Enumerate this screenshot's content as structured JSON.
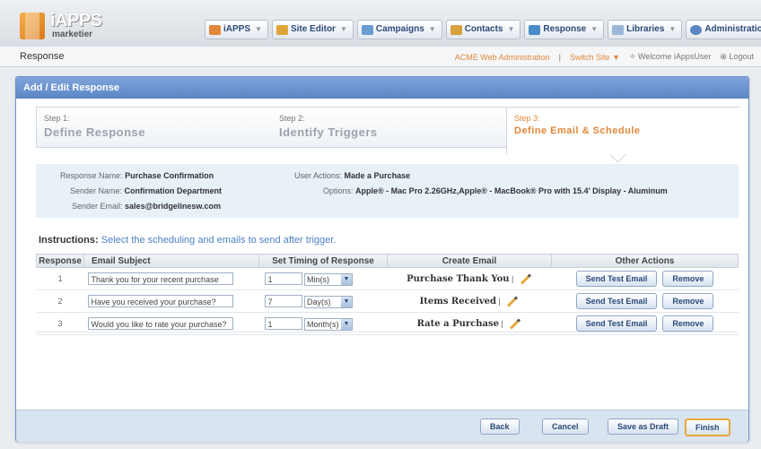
{
  "app": {
    "logo_title": "iAPPS",
    "logo_sub": "marketier"
  },
  "nav": [
    {
      "label": "iAPPS",
      "color": "#e0873a"
    },
    {
      "label": "Site Editor",
      "color": "#e0a53a"
    },
    {
      "label": "Campaigns",
      "color": "#6a9bd3"
    },
    {
      "label": "Contacts",
      "color": "#d9a13c"
    },
    {
      "label": "Response",
      "color": "#4a8bc9"
    },
    {
      "label": "Libraries",
      "color": "#9ab7d9"
    },
    {
      "label": "Administration",
      "color": "#5b86c5"
    }
  ],
  "subbar": {
    "page_title": "Response",
    "site_admin": "ACME Web Administration",
    "switch_site": "Switch Site",
    "welcome": "Welcome iAppsUser",
    "logout": "Logout"
  },
  "panel": {
    "title": "Add / Edit Response"
  },
  "steps": [
    {
      "num": "Step 1:",
      "title": "Define Response"
    },
    {
      "num": "Step 2:",
      "title": "Identify Triggers"
    },
    {
      "num": "Step 3:",
      "title": "Define Email & Schedule"
    }
  ],
  "summary": {
    "response_name_label": "Response Name:",
    "response_name": "Purchase Confirmation",
    "sender_name_label": "Sender Name:",
    "sender_name": "Confirmation Department",
    "sender_email_label": "Sender Email:",
    "sender_email": "sales@bridgelinesw.com",
    "user_actions_label": "User Actions:",
    "user_actions": "Made a Purchase",
    "options_label": "Options:",
    "options": "Apple® - Mac Pro 2.26GHz,Apple® - MacBook® Pro with 15.4' Display - Aluminum"
  },
  "instructions": {
    "label": "Instructions:",
    "text": "Select the scheduling and emails to send after trigger."
  },
  "table": {
    "headers": [
      "Response",
      "Email Subject",
      "Set Timing of Response",
      "Create Email",
      "Other Actions"
    ],
    "rows": [
      {
        "num": "1",
        "subject": "Thank you for your recent purchase",
        "timing_value": "1",
        "timing_unit": "Min(s)",
        "email_name": "Purchase Thank You"
      },
      {
        "num": "2",
        "subject": "Have you received your purchase?",
        "timing_value": "7",
        "timing_unit": "Day(s)",
        "email_name": "Items Received"
      },
      {
        "num": "3",
        "subject": "Would you like to rate your purchase?",
        "timing_value": "1",
        "timing_unit": "Month(s)",
        "email_name": "Rate a Purchase"
      }
    ],
    "send_test_label": "Send Test Email",
    "remove_label": "Remove"
  },
  "footer": {
    "back": "Back",
    "cancel": "Cancel",
    "save_draft": "Save as Draft",
    "finish": "Finish"
  }
}
